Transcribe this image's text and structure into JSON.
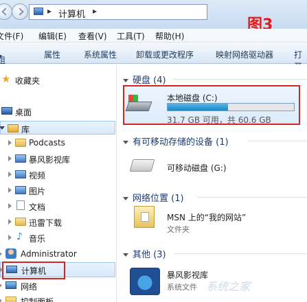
{
  "address": {
    "crumb": "计算机",
    "sep1": "▸",
    "sep2": "▸"
  },
  "annotation": "图3",
  "menu": [
    "文件(F)",
    "编辑(E)",
    "查看(V)",
    "工具(T)",
    "帮助(H)"
  ],
  "toolbar": {
    "organize": "组织",
    "caret": "▼",
    "items": [
      "属性",
      "系统属性",
      "卸载或更改程序",
      "映射网络驱动器",
      "打开"
    ]
  },
  "sidebar": {
    "favorites": "收藏夹",
    "desktop": "桌面",
    "libraries": "库",
    "lib_items": [
      "Podcasts",
      "暴风影视库",
      "视频",
      "图片",
      "文档",
      "迅雷下载",
      "音乐"
    ],
    "user": "Administrator",
    "computer": "计算机",
    "network": "网络",
    "control_panel": "控制面板"
  },
  "content": {
    "hdd_group": "硬盘 (4)",
    "local_disk": {
      "name": "本地磁盘 (C:)",
      "free_text": "31.7 GB 可用，共 60.6 GB",
      "used_fraction": 0.48
    },
    "removable_group": "有可移动存储的设备 (1)",
    "removable_disk": "可移动磁盘 (G:)",
    "network_group": "网络位置 (1)",
    "msn": {
      "name": "MSN 上的“我的网站”",
      "type": "文件夹"
    },
    "other_group": "其他 (3)",
    "other_item": {
      "name": "暴风影视库",
      "type": "系统文件"
    }
  },
  "brand": "系统之家"
}
